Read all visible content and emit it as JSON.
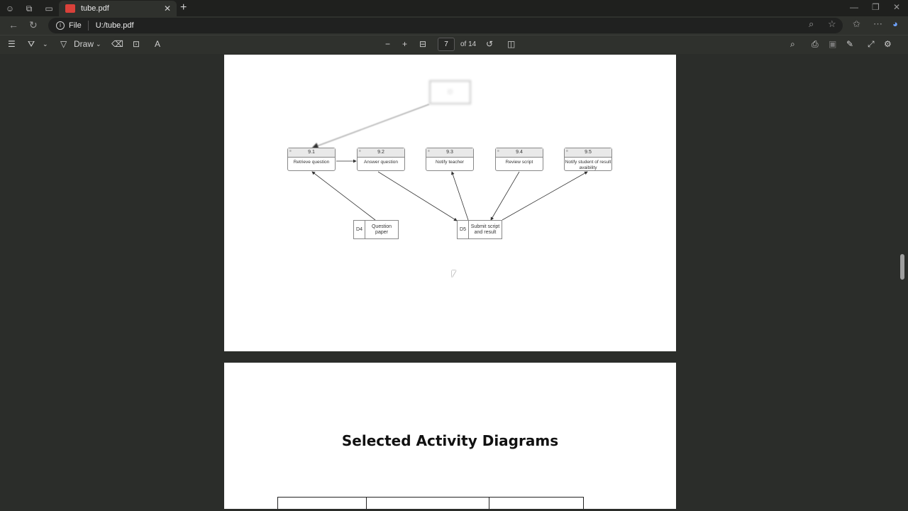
{
  "browser": {
    "tab_title": "tube.pdf",
    "address_scheme": "File",
    "address_url": "U:/tube.pdf"
  },
  "pdf_toolbar": {
    "draw_label": "Draw",
    "page_current": "7",
    "page_total": "of 14"
  },
  "diagram": {
    "processes": [
      {
        "num": "9.1",
        "label": "Retrieve question"
      },
      {
        "num": "9.2",
        "label": "Answer question"
      },
      {
        "num": "9.3",
        "label": "Notify teacher"
      },
      {
        "num": "9.4",
        "label": "Review script"
      },
      {
        "num": "9.5",
        "label": "Notify student of result avaibility"
      }
    ],
    "stores": [
      {
        "id": "D4",
        "name": "Question paper"
      },
      {
        "id": "D5",
        "name": "Submit script and result"
      }
    ]
  },
  "page2": {
    "heading": "Selected Activity Diagrams"
  },
  "colors": {
    "viewer_bg": "#2b2d2a",
    "toolbar_bg": "#2f312d",
    "pdf_tab_icon": "#d9413a"
  }
}
